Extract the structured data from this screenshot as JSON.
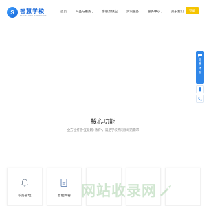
{
  "header": {
    "logo": {
      "mark": "S",
      "name_cn": "智慧学校",
      "name_en": "SMART EDU SOFTWARE"
    },
    "nav": [
      {
        "label": "首页",
        "has_caret": false
      },
      {
        "label": "产品与服务",
        "has_caret": true
      },
      {
        "label": "客服点供应",
        "has_caret": false
      },
      {
        "label": "资讯服务",
        "has_caret": false
      },
      {
        "label": "服务中心",
        "has_caret": true
      },
      {
        "label": "关于我们",
        "has_caret": false
      }
    ],
    "login_label": "登录"
  },
  "section": {
    "title": "核心功能",
    "subtitle": "全方位打造“互联网+教育”，满足学校不同领域的需求"
  },
  "cards": [
    {
      "label": "校务管理",
      "icon": "bell-icon"
    },
    {
      "label": "智能阅卷",
      "icon": "document-icon"
    },
    {
      "label": "",
      "icon": ""
    },
    {
      "label": "",
      "icon": ""
    },
    {
      "label": "",
      "icon": ""
    }
  ],
  "float": {
    "main_text": "免费体验",
    "icons": [
      "chat-icon",
      "qq-icon",
      "phone-icon"
    ]
  },
  "watermark": {
    "text": "网站收录网"
  },
  "colors": {
    "accent": "#2f86e8",
    "login": "#f5c400"
  }
}
